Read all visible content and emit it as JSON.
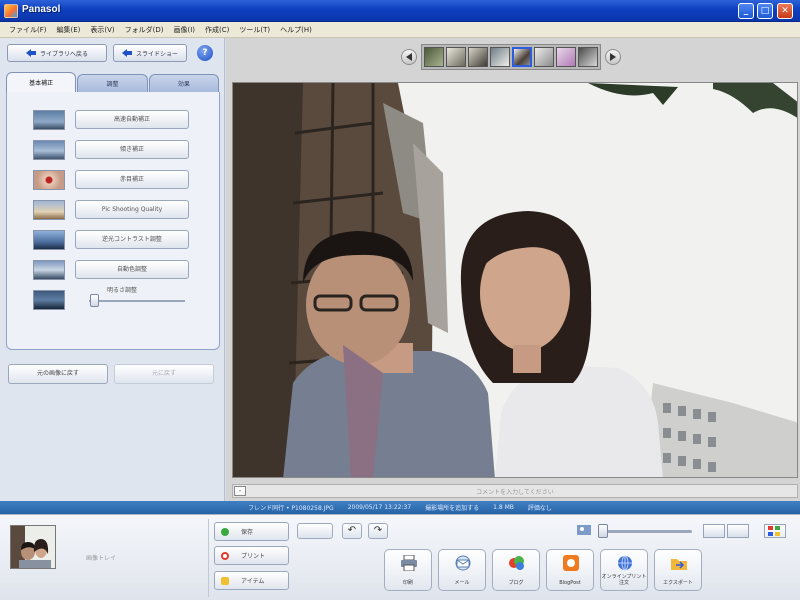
{
  "window": {
    "title": "Panasol",
    "min_label": "_",
    "max_label": "□",
    "close_label": "✕"
  },
  "menu": [
    "ファイル(F)",
    "編集(E)",
    "表示(V)",
    "フォルダ(D)",
    "画像(I)",
    "作成(C)",
    "ツール(T)",
    "ヘルプ(H)"
  ],
  "left": {
    "back_label": "ライブラリへ戻る",
    "prev_label": "スライドショー",
    "help_label": "?",
    "tabs": [
      "基本補正",
      "調整",
      "効果"
    ],
    "fx_buttons": [
      "高速自動補正",
      "傾き補正",
      "赤目補正",
      "Pic Shooting Quality",
      "逆光コントラスト調整",
      "自動色調整"
    ],
    "slider_label": "明るさ調整",
    "original_label": "元の画像に戻す",
    "apply_label": "元に戻す"
  },
  "viewer": {
    "comment_placeholder": "コメントを入力してください",
    "comment_toggle": "-"
  },
  "info": [
    "フレンド同行 • P1080258.JPG",
    "2009/05/17 13:22:37",
    "撮影場所を追加する",
    "1.8 MB",
    "評価なし"
  ],
  "tray": {
    "label": "画像トレイ"
  },
  "actions": {
    "save_label": "保存",
    "print_label": "プリント",
    "rotate_left": "↶",
    "rotate_right": "↷",
    "blank": "",
    "buttons": [
      "印刷",
      "メール",
      "ブログ",
      "BlogPost",
      "オンラインプリント注文",
      "エクスポート"
    ]
  },
  "colors": {
    "accent": "#2b5ce2",
    "title_bar": "#0d3fbf",
    "info_bar": "#2764a6"
  },
  "icons": [
    "app-icon",
    "minimize-icon",
    "maximize-icon",
    "close-icon",
    "back-arrow-icon",
    "help-icon",
    "prev-icon",
    "next-icon",
    "printer-icon",
    "mail-icon",
    "blog-icon",
    "blogpost-icon",
    "online-print-icon",
    "export-icon"
  ]
}
